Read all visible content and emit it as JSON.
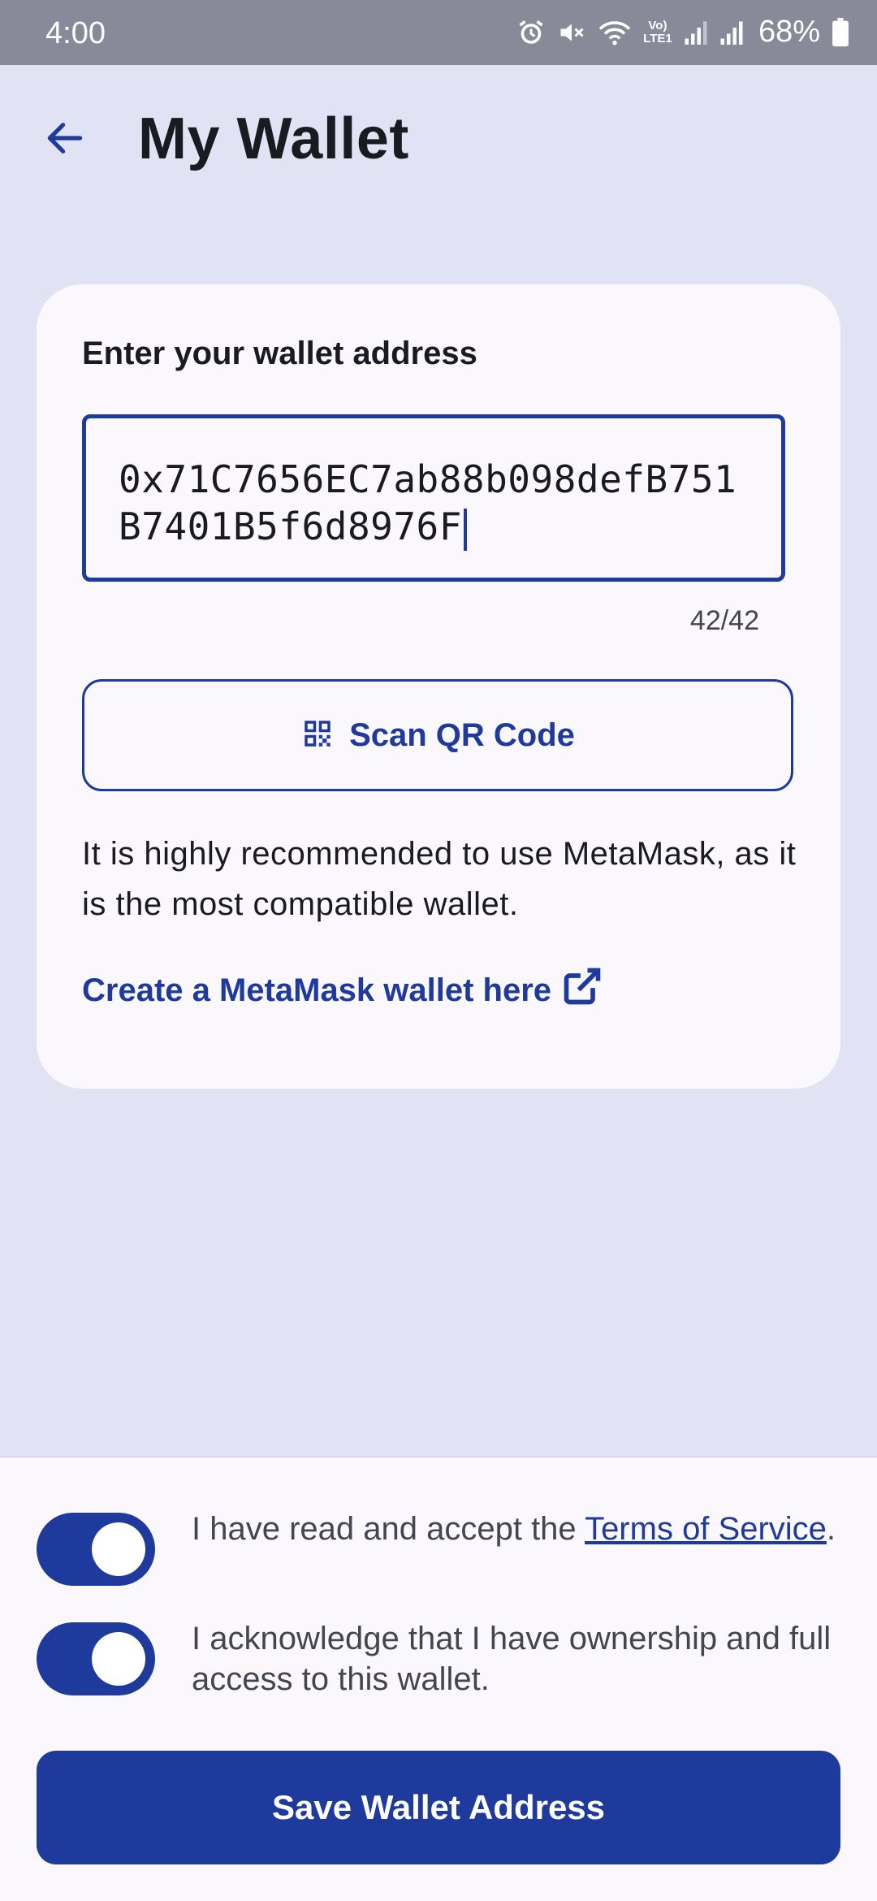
{
  "status_bar": {
    "time": "4:00",
    "battery": "68%",
    "network_label": "Vo) LTE1",
    "icons": [
      "alarm-icon",
      "mute-icon",
      "wifi-icon",
      "signal-icon",
      "signal-icon",
      "battery-icon"
    ]
  },
  "header": {
    "title": "My Wallet",
    "back_icon": "arrow-left-icon"
  },
  "wallet_form": {
    "label": "Enter your wallet address",
    "address_value": "0x71C7656EC7ab88b098defB751B7401B5f6d8976F",
    "char_count": "42/42",
    "scan_button_label": "Scan QR Code",
    "scan_icon": "qr-code-icon",
    "recommendation": "It is highly recommended to use MetaMask, as it is the most compatible wallet.",
    "create_link_label": "Create a MetaMask wallet here",
    "create_link_icon": "external-link-icon"
  },
  "agreements": {
    "terms_prefix": "I have read and accept the ",
    "terms_link": "Terms of Service",
    "terms_suffix": ".",
    "terms_checked": true,
    "ownership_text": "I acknowledge that I have ownership and full access to this wallet.",
    "ownership_checked": true
  },
  "save_button_label": "Save Wallet Address",
  "colors": {
    "primary": "#1e3a9c",
    "background": "#e1e3f4",
    "surface": "#fbf8fd",
    "status_bar": "#888a99"
  }
}
